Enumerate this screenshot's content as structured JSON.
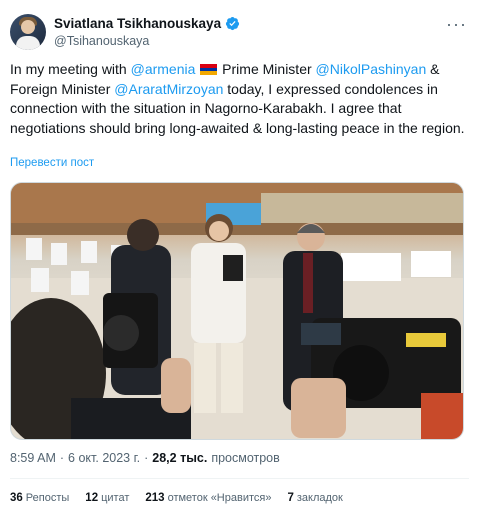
{
  "author": {
    "name": "Sviatlana Tsikhanouskaya",
    "handle": "@Tsihanouskaya",
    "avatar_icon": "user-avatar",
    "verified_icon": "verified-badge-icon"
  },
  "more_icon": "more-options-icon",
  "tweet": {
    "p1": "In my meeting with ",
    "mention_armenia": "@armenia",
    "p2": " Prime Minister ",
    "mention_pm": "@NikolPashinyan",
    "p3": " & Foreign Minister ",
    "mention_fm": "@AraratMirzoyan",
    "p4": " today, I expressed condolences in connection with the situation in Nagorno-Karabakh. I agree that negotiations should bring long-awaited & long-lasting peace in the region."
  },
  "translate_link": "Перевести пост",
  "photo": {
    "icon": "tweet-photo"
  },
  "meta": {
    "time": "8:59 AM",
    "sep1": "·",
    "date": "6 окт. 2023 г.",
    "sep2": "·",
    "views_count": "28,2 тыс.",
    "views_label": "просмотров"
  },
  "stats": {
    "reposts_count": "36",
    "reposts_label": "Репосты",
    "quotes_count": "12",
    "quotes_label": "цитат",
    "likes_count": "213",
    "likes_label": "отметок «Нравится»",
    "bookmarks_count": "7",
    "bookmarks_label": "закладок"
  },
  "colors": {
    "link": "#1d9bf0",
    "text": "#0f1419",
    "secondary": "#536471",
    "divider": "#eff3f4"
  }
}
